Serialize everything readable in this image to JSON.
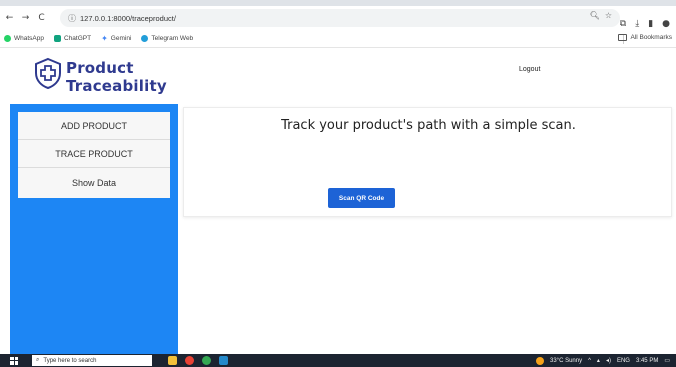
{
  "browser": {
    "url": "127.0.0.1:8000/traceproduct/",
    "nav": {
      "back": "←",
      "forward": "→",
      "reload": "C"
    },
    "bookmarks": [
      {
        "label": "WhatsApp",
        "color": "#25d366"
      },
      {
        "label": "ChatGPT",
        "color": "#10a37f"
      },
      {
        "label": "Gemini",
        "color": "#4285f4"
      },
      {
        "label": "Telegram Web",
        "color": "#229ed9"
      }
    ],
    "all_bookmarks": "All Bookmarks"
  },
  "header": {
    "logo_line1": "Product",
    "logo_line2": "Traceability",
    "logout": "Logout"
  },
  "sidebar": {
    "items": [
      {
        "label": "ADD PRODUCT"
      },
      {
        "label": "TRACE PRODUCT"
      },
      {
        "label": "Show Data"
      }
    ]
  },
  "main": {
    "headline": "Track your product's path with a simple scan.",
    "scan_button": "Scan QR Code"
  },
  "taskbar": {
    "search_placeholder": "Type here to search",
    "weather": "33°C  Sunny",
    "language": "ENG",
    "time": "3:45 PM"
  },
  "colors": {
    "sidebar": "#1d86f4",
    "brand": "#2f3a8f",
    "button": "#1d63d6",
    "taskbar": "#1c2431"
  }
}
